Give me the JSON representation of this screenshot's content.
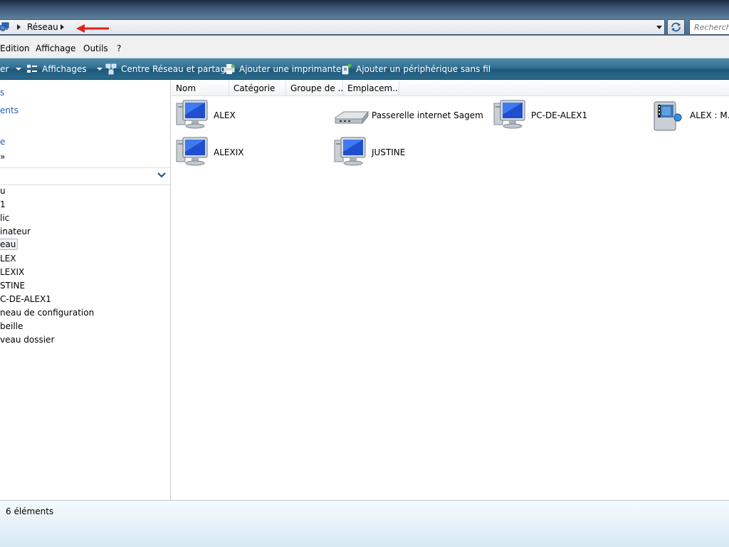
{
  "address": {
    "crumb": "Réseau",
    "search_placeholder": "Recherche"
  },
  "menu": {
    "edit": "Edition",
    "view": "Affichage",
    "tools": "Outils",
    "help": "?"
  },
  "commands": {
    "organize_partial": "er",
    "views": "Affichages",
    "network_center": "Centre Réseau et partage",
    "add_printer": "Ajouter une imprimante",
    "add_wireless": "Ajouter un périphérique sans fil"
  },
  "nav": {
    "favorites": [
      {
        "label": "s",
        "link": true
      },
      {
        "label": "ents",
        "link": true
      },
      {
        "label": "e",
        "link": true
      },
      {
        "label": "»",
        "link": false
      }
    ],
    "tree": [
      "u",
      "1",
      "lic",
      "inateur",
      "eau",
      "LEX",
      "LEXIX",
      "STINE",
      "C-DE-ALEX1",
      "neau de configuration",
      "beille",
      "veau dossier"
    ],
    "selected_index": 4
  },
  "columns": [
    "Nom",
    "Catégorie",
    "Groupe de ...",
    "Emplacem..."
  ],
  "items": [
    {
      "label": "ALEX",
      "icon": "computer-icon"
    },
    {
      "label": "Passerelle internet Sagem",
      "icon": "router-icon"
    },
    {
      "label": "PC-DE-ALEX1",
      "icon": "computer-icon"
    },
    {
      "label": "ALEX : M. I",
      "icon": "media-device-icon"
    },
    {
      "label": "ALEXIX",
      "icon": "computer-icon"
    },
    {
      "label": "JUSTINE",
      "icon": "computer-icon"
    }
  ],
  "status": {
    "count": "6 éléments"
  },
  "colors": {
    "command_bar": "#2f6d8e",
    "link": "#1a5fb4",
    "annotation_arrow": "#e02020"
  }
}
